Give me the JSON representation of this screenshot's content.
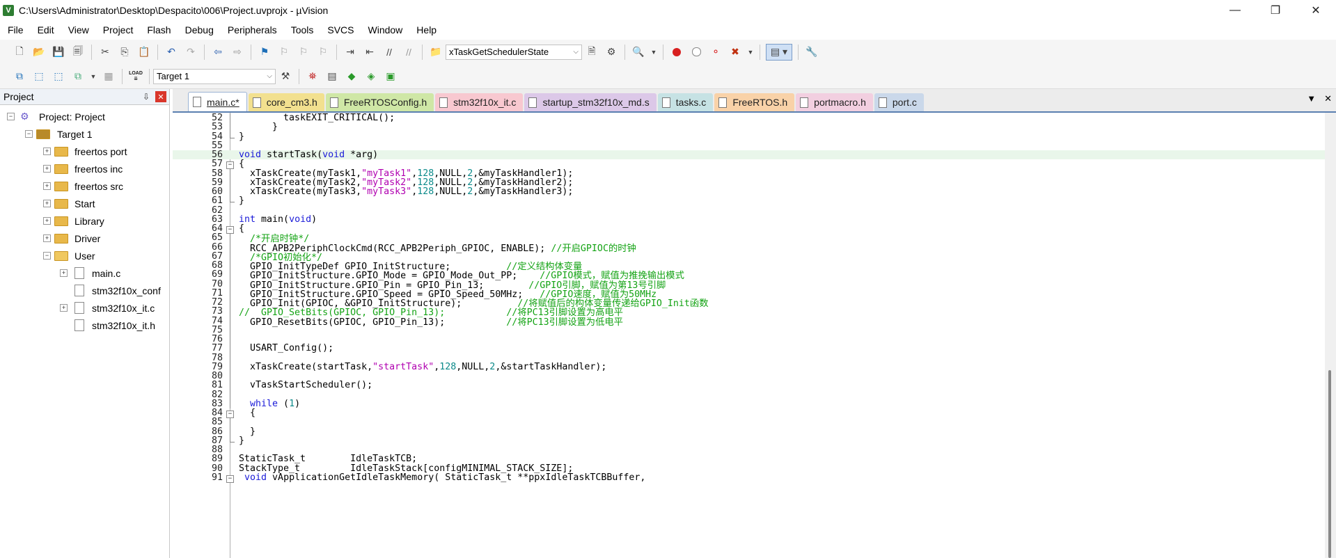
{
  "window": {
    "title": "C:\\Users\\Administrator\\Desktop\\Despacito\\006\\Project.uvprojx - µVision",
    "app_icon_text": "V",
    "controls": [
      "—",
      "❐",
      "✕"
    ]
  },
  "menu": [
    "File",
    "Edit",
    "View",
    "Project",
    "Flash",
    "Debug",
    "Peripherals",
    "Tools",
    "SVCS",
    "Window",
    "Help"
  ],
  "toolbar": {
    "function_combo": "xTaskGetSchedulerState",
    "target_combo": "Target 1",
    "load_label": "LOAD"
  },
  "project_panel": {
    "title": "Project",
    "pin": "⇩",
    "close": "✕",
    "tree": [
      {
        "label": "Project: Project",
        "type": "root",
        "expander": "−"
      },
      {
        "label": "Target 1",
        "type": "target",
        "expander": "−"
      },
      {
        "label": "freertos port",
        "type": "folder",
        "expander": "+"
      },
      {
        "label": "freertos inc",
        "type": "folder",
        "expander": "+"
      },
      {
        "label": "freertos src",
        "type": "folder",
        "expander": "+"
      },
      {
        "label": "Start",
        "type": "folder",
        "expander": "+"
      },
      {
        "label": "Library",
        "type": "folder",
        "expander": "+"
      },
      {
        "label": "Driver",
        "type": "folder",
        "expander": "+"
      },
      {
        "label": "User",
        "type": "folder",
        "expander": "−"
      },
      {
        "label": "main.c",
        "type": "file",
        "expander": "+"
      },
      {
        "label": "stm32f10x_conf",
        "type": "file",
        "expander": ""
      },
      {
        "label": "stm32f10x_it.c",
        "type": "file",
        "expander": "+"
      },
      {
        "label": "stm32f10x_it.h",
        "type": "file",
        "expander": ""
      }
    ]
  },
  "tabs": [
    {
      "label": "main.c*",
      "color": "#ffffff",
      "active": true
    },
    {
      "label": "core_cm3.h",
      "color": "#f2e08f"
    },
    {
      "label": "FreeRTOSConfig.h",
      "color": "#cfe7a6"
    },
    {
      "label": "stm32f10x_it.c",
      "color": "#f8c8d0"
    },
    {
      "label": "startup_stm32f10x_md.s",
      "color": "#dcc8e8"
    },
    {
      "label": "tasks.c",
      "color": "#c6e2e4"
    },
    {
      "label": "FreeRTOS.h",
      "color": "#f9d2a8"
    },
    {
      "label": "portmacro.h",
      "color": "#f2cfe0"
    },
    {
      "label": "port.c",
      "color": "#cad8ea"
    }
  ],
  "tab_controls": [
    "▼",
    "✕"
  ],
  "code_lines": [
    {
      "n": "52",
      "f": "bar",
      "t": "        taskEXIT_CRITICAL();"
    },
    {
      "n": "53",
      "f": "bar",
      "t": "      }"
    },
    {
      "n": "54",
      "f": "end",
      "t": "}"
    },
    {
      "n": "55",
      "f": "",
      "t": ""
    },
    {
      "n": "56",
      "f": "",
      "t": "void startTask(void *arg)",
      "hl": true
    },
    {
      "n": "57",
      "f": "box",
      "t": "{"
    },
    {
      "n": "58",
      "f": "bar",
      "t": "  xTaskCreate(myTask1,\"myTask1\",128,NULL,2,&myTaskHandler1);"
    },
    {
      "n": "59",
      "f": "bar",
      "t": "  xTaskCreate(myTask2,\"myTask2\",128,NULL,2,&myTaskHandler2);"
    },
    {
      "n": "60",
      "f": "bar",
      "t": "  xTaskCreate(myTask3,\"myTask3\",128,NULL,2,&myTaskHandler3);"
    },
    {
      "n": "61",
      "f": "end",
      "t": "}"
    },
    {
      "n": "62",
      "f": "",
      "t": ""
    },
    {
      "n": "63",
      "f": "",
      "t": "int main(void)"
    },
    {
      "n": "64",
      "f": "box",
      "t": "{"
    },
    {
      "n": "65",
      "f": "bar",
      "t": "  /*开启时钟*/"
    },
    {
      "n": "66",
      "f": "bar",
      "t": "  RCC_APB2PeriphClockCmd(RCC_APB2Periph_GPIOC, ENABLE); //开启GPIOC的时钟"
    },
    {
      "n": "67",
      "f": "bar",
      "t": "  /*GPIO初始化*/"
    },
    {
      "n": "68",
      "f": "bar",
      "t": "  GPIO_InitTypeDef GPIO_InitStructure;          //定义结构体变量"
    },
    {
      "n": "69",
      "f": "bar",
      "t": "  GPIO_InitStructure.GPIO_Mode = GPIO_Mode_Out_PP;    //GPIO模式，赋值为推挽输出模式"
    },
    {
      "n": "70",
      "f": "bar",
      "t": "  GPIO_InitStructure.GPIO_Pin = GPIO_Pin_13;        //GPIO引脚，赋值为第13号引脚"
    },
    {
      "n": "71",
      "f": "bar",
      "t": "  GPIO_InitStructure.GPIO_Speed = GPIO_Speed_50MHz;   //GPIO速度，赋值为50MHz"
    },
    {
      "n": "72",
      "f": "bar",
      "t": "  GPIO_Init(GPIOC, &GPIO_InitStructure);          //将赋值后的构体变量传递给GPIO_Init函数"
    },
    {
      "n": "73",
      "f": "bar",
      "t": "//  GPIO_SetBits(GPIOC, GPIO_Pin_13);           //将PC13引脚设置为高电平"
    },
    {
      "n": "74",
      "f": "bar",
      "t": "  GPIO_ResetBits(GPIOC, GPIO_Pin_13);           //将PC13引脚设置为低电平"
    },
    {
      "n": "75",
      "f": "bar",
      "t": ""
    },
    {
      "n": "76",
      "f": "bar",
      "t": ""
    },
    {
      "n": "77",
      "f": "bar",
      "t": "  USART_Config();"
    },
    {
      "n": "78",
      "f": "bar",
      "t": ""
    },
    {
      "n": "79",
      "f": "bar",
      "t": "  xTaskCreate(startTask,\"startTask\",128,NULL,2,&startTaskHandler);"
    },
    {
      "n": "80",
      "f": "bar",
      "t": ""
    },
    {
      "n": "81",
      "f": "bar",
      "t": "  vTaskStartScheduler();"
    },
    {
      "n": "82",
      "f": "bar",
      "t": ""
    },
    {
      "n": "83",
      "f": "bar",
      "t": "  while (1)"
    },
    {
      "n": "84",
      "f": "box",
      "t": "  {"
    },
    {
      "n": "85",
      "f": "bar",
      "t": ""
    },
    {
      "n": "86",
      "f": "bar",
      "t": "  }"
    },
    {
      "n": "87",
      "f": "end",
      "t": "}"
    },
    {
      "n": "88",
      "f": "",
      "t": ""
    },
    {
      "n": "89",
      "f": "",
      "t": "StaticTask_t        IdleTaskTCB;"
    },
    {
      "n": "90",
      "f": "",
      "t": "StackType_t         IdleTaskStack[configMINIMAL_STACK_SIZE];"
    },
    {
      "n": "91",
      "f": "box",
      "t": " void vApplicationGetIdleTaskMemory( StaticTask_t **ppxIdleTaskTCBBuffer,"
    }
  ],
  "colors": {
    "keyword": "#1a1ad8",
    "string": "#b000b0",
    "number": "#0b8a8a",
    "comment": "#14a314",
    "current_line": "#e9f6ea"
  }
}
